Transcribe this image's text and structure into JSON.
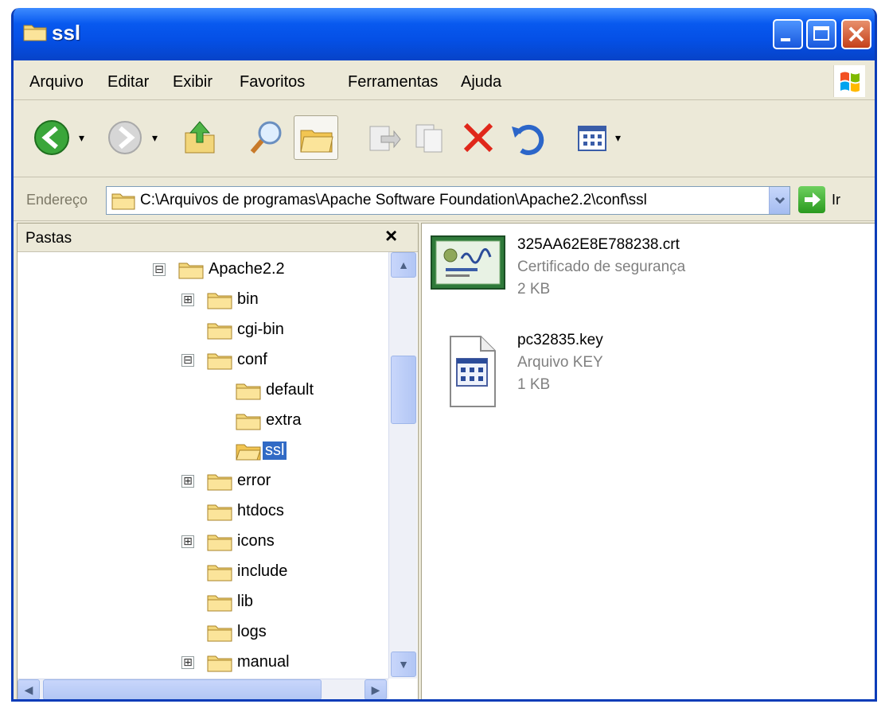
{
  "window": {
    "title": "ssl"
  },
  "menu": [
    {
      "label": "Arquivo"
    },
    {
      "label": "Editar"
    },
    {
      "label": "Exibir"
    },
    {
      "label": "Favoritos"
    },
    {
      "label": "Ferramentas"
    },
    {
      "label": "Ajuda"
    }
  ],
  "toolbar": {
    "buttons": [
      "back-icon",
      "forward-icon",
      "up-folder-icon",
      "search-icon",
      "folders-icon",
      "move-to-icon",
      "copy-to-icon",
      "delete-icon",
      "undo-icon",
      "views-icon"
    ]
  },
  "address": {
    "label": "Endereço",
    "path": "C:\\Arquivos de programas\\Apache Software Foundation\\Apache2.2\\conf\\ssl",
    "go_label": "Ir"
  },
  "folders_pane": {
    "title": "Pastas",
    "close_label": "×",
    "tree": [
      {
        "label": "Apache2.2",
        "expander": "⊟"
      },
      {
        "label": "bin",
        "expander": "⊞"
      },
      {
        "label": "cgi-bin",
        "expander": ""
      },
      {
        "label": "conf",
        "expander": "⊟"
      },
      {
        "label": "default",
        "expander": ""
      },
      {
        "label": "extra",
        "expander": ""
      },
      {
        "label": "ssl",
        "expander": "",
        "selected": true
      },
      {
        "label": "error",
        "expander": "⊞"
      },
      {
        "label": "htdocs",
        "expander": ""
      },
      {
        "label": "icons",
        "expander": "⊞"
      },
      {
        "label": "include",
        "expander": ""
      },
      {
        "label": "lib",
        "expander": ""
      },
      {
        "label": "logs",
        "expander": ""
      },
      {
        "label": "manual",
        "expander": "⊞"
      }
    ]
  },
  "files": [
    {
      "name": "325AA62E8E788238.crt",
      "type": "Certificado de segurança",
      "size": "2 KB",
      "icon": "certificate-icon"
    },
    {
      "name": "pc32835.key",
      "type": "Arquivo KEY",
      "size": "1 KB",
      "icon": "key-file-icon"
    }
  ],
  "colors": {
    "selection": "#316ac5",
    "titlebar": "#0550e6"
  }
}
